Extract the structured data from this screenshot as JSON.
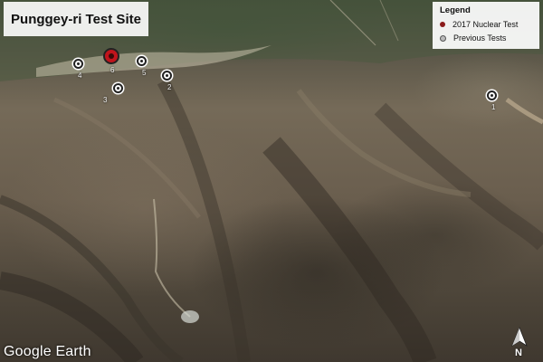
{
  "map": {
    "title": "Punggey-ri Test Site",
    "legend": {
      "title": "Legend",
      "items": [
        {
          "label": "2017 Nuclear Test",
          "color": "#8b1a1a",
          "icon": "red-dot-icon"
        },
        {
          "label": "Previous Tests",
          "color": "#999999",
          "icon": "gray-target-icon"
        }
      ]
    },
    "markers": [
      {
        "label": "1",
        "type": "previous"
      },
      {
        "label": "2",
        "type": "previous"
      },
      {
        "label": "3",
        "type": "previous"
      },
      {
        "label": "4",
        "type": "previous"
      },
      {
        "label": "5",
        "type": "previous"
      },
      {
        "label": "6",
        "type": "2017"
      }
    ],
    "attribution": "Google Earth",
    "north_indicator": "N"
  }
}
